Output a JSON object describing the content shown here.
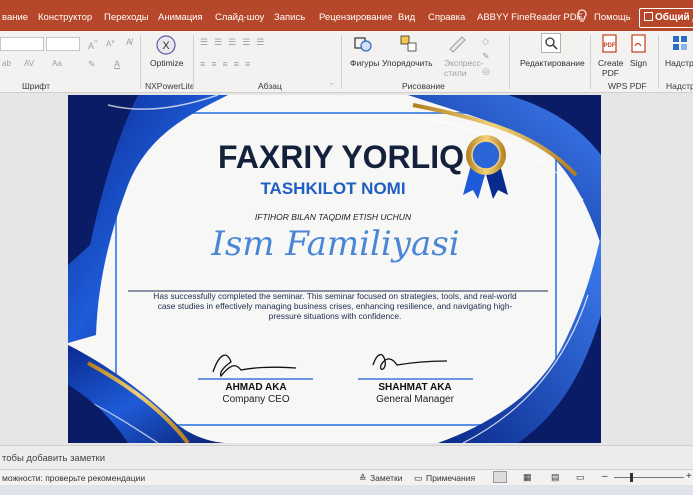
{
  "menu": {
    "tabs": [
      "вание",
      "Конструктор",
      "Переходы",
      "Анимация",
      "Слайд-шоу",
      "Запись",
      "Рецензирование",
      "Вид",
      "Справка",
      "ABBYY FineReader PDF"
    ],
    "help": "Помощь",
    "share": "Общий д"
  },
  "ribbon": {
    "groups": {
      "font": "Шрифт",
      "nxpowerlite": "NXPowerLite",
      "paragraph": "Абзац",
      "drawing": "Рисование",
      "wps_pdf": "WPS PDF",
      "addins": "Надстр"
    },
    "optimize": "Optimize",
    "shapes": "Фигуры",
    "arrange": "Упорядочить",
    "express_styles_1": "Экспресс-",
    "express_styles_2": "стили",
    "editing": "Редактирование",
    "create_pdf_1": "Create",
    "create_pdf_2": "PDF",
    "sign": "Sign",
    "addins_btn": "Надстр"
  },
  "slide": {
    "title": "FAXRIY YORLIQ",
    "organization": "TASHKILOT NOMI",
    "dedication": "IFTIHOR BILAN TAQDIM ETISH UCHUN",
    "recipient": "Ism Familiyasi",
    "body": "Has successfully completed the seminar. This seminar focused on strategies, tools, and real-world case studies in effectively managing business crises, enhancing resilience, and navigating high-pressure situations with confidence.",
    "signers": [
      {
        "name": "AHMAD AKA",
        "role": "Company CEO"
      },
      {
        "name": "SHAHMAT AKA",
        "role": "General Manager"
      }
    ]
  },
  "notes_placeholder": "тобы добавить заметки",
  "status": {
    "accessibility": "можности: проверьте рекомендации",
    "notes": "Заметки",
    "comments": "Примечания"
  },
  "colors": {
    "accent": "#b7472a",
    "navy": "#14213d",
    "blue": "#1f5fbf",
    "gold": "#d4a537"
  }
}
